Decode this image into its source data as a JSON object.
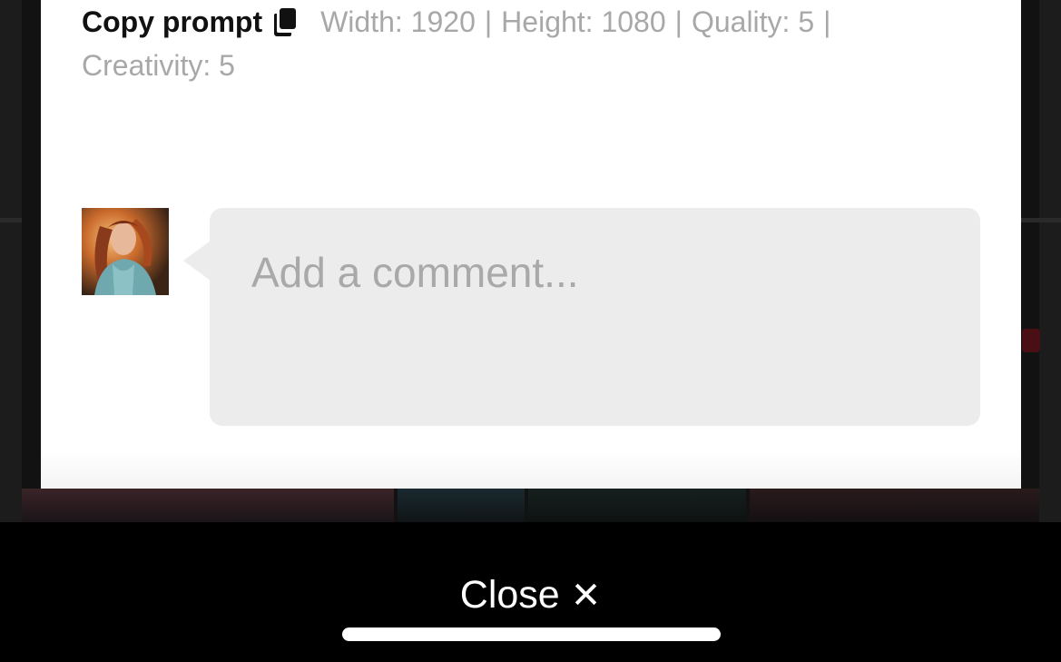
{
  "prompt_info": {
    "copy_label": "Copy prompt",
    "width": "Width: 1920",
    "height": "Height: 1080",
    "quality": "Quality: 5",
    "creativity": "Creativity: 5",
    "separator": "|"
  },
  "comment": {
    "placeholder": "Add a comment..."
  },
  "bottom": {
    "close_label": "Close",
    "close_glyph": "✕"
  },
  "icons": {
    "copy": "copy-icon",
    "close": "close-icon"
  },
  "colors": {
    "meta_text": "#a8a8a8",
    "comment_bg": "#ececec",
    "bottom_bar": "#000000"
  }
}
